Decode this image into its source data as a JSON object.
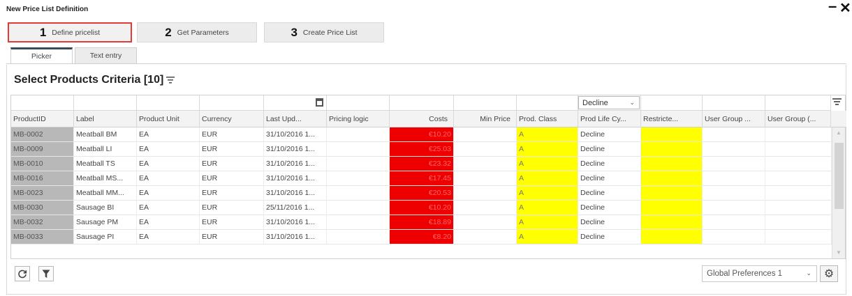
{
  "window": {
    "title": "New Price List Definition",
    "minimize_glyph": "—",
    "close_glyph": "✕"
  },
  "wizard_steps": [
    {
      "number": "1",
      "label": "Define pricelist"
    },
    {
      "number": "2",
      "label": "Get Parameters"
    },
    {
      "number": "3",
      "label": "Create Price List"
    }
  ],
  "sub_tabs": [
    "Picker",
    "Text entry"
  ],
  "section": {
    "title": "Select Products Criteria [10]",
    "filter_icon": "filter-lines-icon"
  },
  "filters": {
    "prod_life_cycle": "Decline"
  },
  "table": {
    "columns": [
      "ProductID",
      "Label",
      "Product Unit",
      "Currency",
      "Last Upd...",
      "Pricing logic",
      "Costs",
      "Min Price",
      "Prod. Class",
      "Prod Life Cy...",
      "Restricte...",
      "User Group ...",
      "User Group (..."
    ],
    "rows": [
      [
        "MB-0002",
        "Meatball BM",
        "EA",
        "EUR",
        "31/10/2016 1...",
        "",
        "€10.20",
        "",
        "A",
        "Decline",
        "",
        "",
        ""
      ],
      [
        "MB-0009",
        "Meatball LI",
        "EA",
        "EUR",
        "31/10/2016 1...",
        "",
        "€25.03",
        "",
        "A",
        "Decline",
        "",
        "",
        ""
      ],
      [
        "MB-0010",
        "Meatball TS",
        "EA",
        "EUR",
        "31/10/2016 1...",
        "",
        "€23.32",
        "",
        "A",
        "Decline",
        "",
        "",
        ""
      ],
      [
        "MB-0016",
        "Meatball MS...",
        "EA",
        "EUR",
        "31/10/2016 1...",
        "",
        "€17.45",
        "",
        "A",
        "Decline",
        "",
        "",
        ""
      ],
      [
        "MB-0023",
        "Meatball MM...",
        "EA",
        "EUR",
        "31/10/2016 1...",
        "",
        "€20.53",
        "",
        "A",
        "Decline",
        "",
        "",
        ""
      ],
      [
        "MB-0030",
        "Sausage BI",
        "EA",
        "EUR",
        "25/11/2016 1...",
        "",
        "€10.20",
        "",
        "A",
        "Decline",
        "",
        "",
        ""
      ],
      [
        "MB-0032",
        "Sausage PM",
        "EA",
        "EUR",
        "31/10/2016 1...",
        "",
        "€18.89",
        "",
        "A",
        "Decline",
        "",
        "",
        ""
      ],
      [
        "MB-0033",
        "Sausage PI",
        "EA",
        "EUR",
        "31/10/2016 1...",
        "",
        "€8.20",
        "",
        "A",
        "Decline",
        "",
        "",
        ""
      ]
    ]
  },
  "footer": {
    "refresh_icon": "refresh-icon",
    "filter_icon": "funnel-icon",
    "preferences_value": "Global Preferences 1",
    "settings_icon": "gear-icon"
  },
  "colors": {
    "active_step_border": "#e53935",
    "cost_highlight": "#ee0000",
    "class_highlight": "#ffff00",
    "productid_bg": "#b8b8b8"
  }
}
